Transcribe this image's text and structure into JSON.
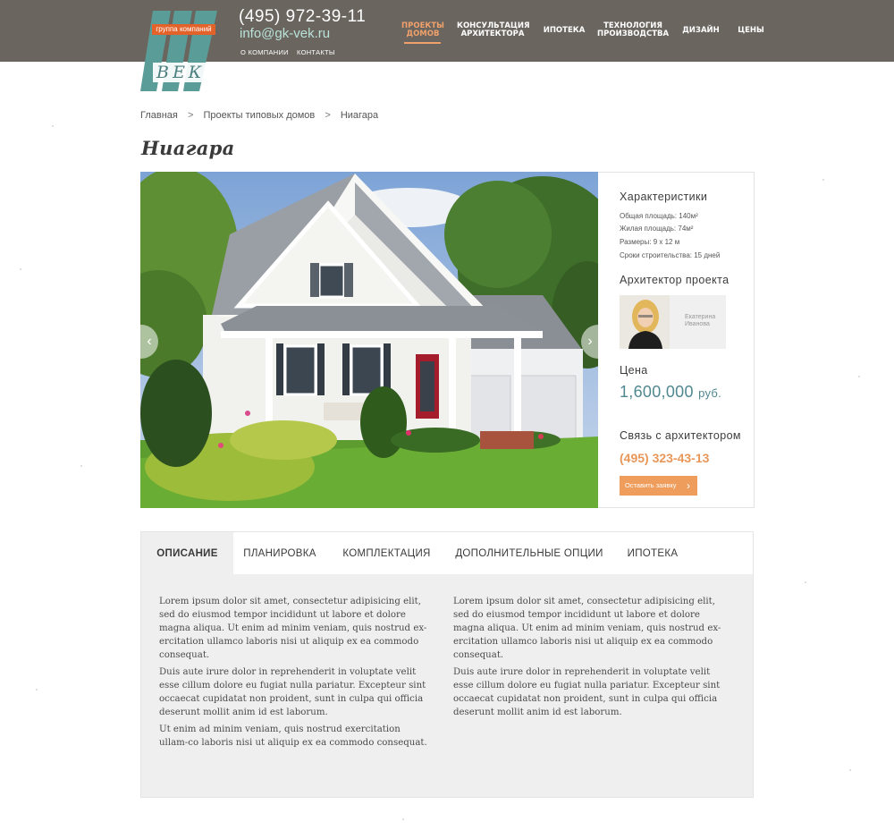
{
  "header": {
    "logo_badge": "группа компаний",
    "logo_letters": [
      "В",
      "Е",
      "К"
    ],
    "phone": "(495) 972-39-11",
    "email": "info@gk-vek.ru",
    "sublinks": [
      "О компании",
      "Контакты"
    ],
    "nav": [
      {
        "line1": "Проекты",
        "line2": "домов",
        "active": true
      },
      {
        "line1": "Консультация",
        "line2": "архитектора",
        "active": false
      },
      {
        "line1": "Ипотека",
        "line2": "",
        "active": false
      },
      {
        "line1": "Технология",
        "line2": "производства",
        "active": false
      },
      {
        "line1": "Дизайн",
        "line2": "",
        "active": false
      },
      {
        "line1": "Цены",
        "line2": "",
        "active": false
      }
    ]
  },
  "breadcrumb": [
    "Главная",
    ">",
    "Проекты типовых домов",
    ">",
    "Ниагара"
  ],
  "page_title": "Ниагара",
  "info": {
    "specs_heading": "Характеристики",
    "specs": [
      "Общая площадь: 140м²",
      "Жилая площадь: 74м²",
      "Размеры: 9 x 12 м",
      "Сроки строительства: 15 дней"
    ],
    "architect_heading": "Архитектор проекта",
    "architect_first": "Екатерина",
    "architect_last": "Иванова",
    "price_heading": "Цена",
    "price": "1,600,000",
    "price_currency": "руб.",
    "contact_heading": "Связь с архитектором",
    "contact_phone": "(495) 323-43-13",
    "order_button": "Оставить заявку"
  },
  "tabs": [
    "Описание",
    "Планировка",
    "Комплектация",
    "Дополнительные опции",
    "Ипотека"
  ],
  "description": {
    "left": [
      "Lorem ipsum dolor sit amet, consectetur adipisicing elit, sed do eiusmod tempor incididunt ut labore et dolore magna aliqua. Ut enim ad minim veniam, quis nostrud ex-ercitation ullamco laboris nisi ut aliquip ex ea commodo consequat.",
      "Duis aute irure dolor in reprehenderit in voluptate velit esse cillum dolore eu fugiat nulla pariatur. Excepteur sint occaecat cupidatat non proident, sunt in culpa qui officia deserunt mollit anim id est laborum.",
      "Ut enim ad minim veniam, quis nostrud exercitation ullam-co laboris nisi ut aliquip ex ea commodo consequat."
    ],
    "right": [
      "Lorem ipsum dolor sit amet, consectetur adipisicing elit, sed do eiusmod tempor incididunt ut labore et dolore magna aliqua. Ut enim ad minim veniam, quis nostrud ex-ercitation ullamco laboris nisi ut aliquip ex ea commodo consequat.",
      "Duis aute irure dolor in reprehenderit in voluptate velit esse cillum dolore eu fugiat nulla pariatur. Excepteur sint occaecat cupidatat non proident, sunt in culpa qui officia deserunt mollit anim id est laborum."
    ]
  },
  "colors": {
    "header_bg": "#6a655f",
    "accent_orange": "#ee9d5c",
    "accent_teal": "#4f8890"
  }
}
